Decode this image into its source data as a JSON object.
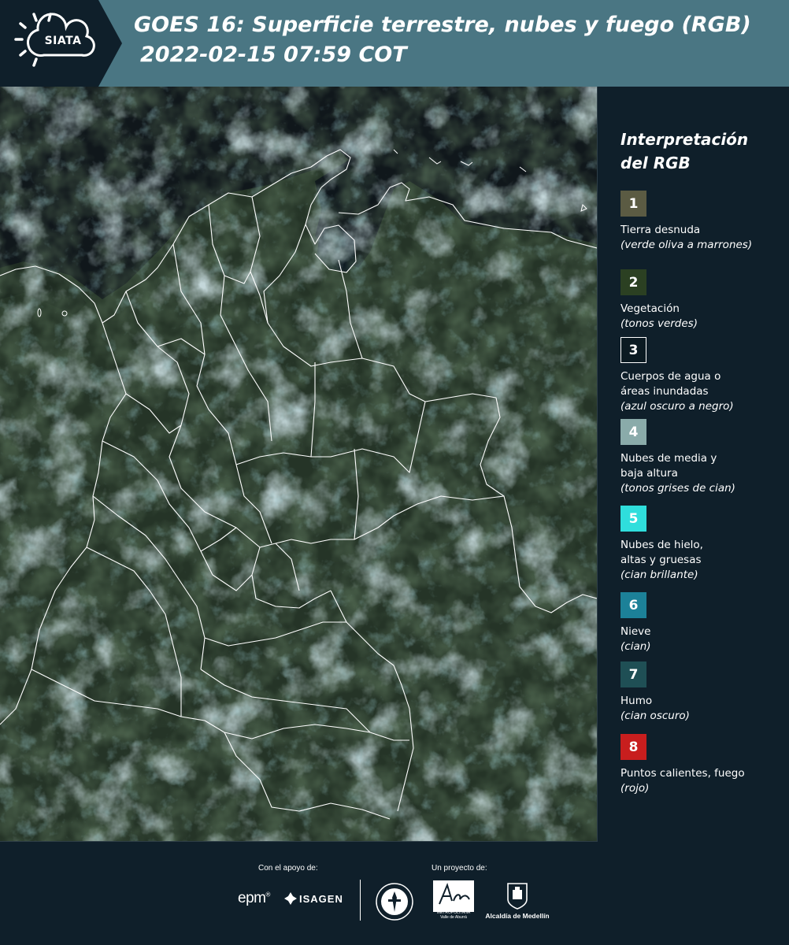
{
  "header": {
    "logo_text": "SIATA",
    "title_line1": "GOES 16: Superficie terrestre, nubes y fuego (RGB)",
    "title_line2": "2022-02-15 07:59 COT"
  },
  "map": {
    "type": "satellite-rgb-composite",
    "background_colors": {
      "sea": "#0f1519",
      "land": "#243226",
      "cloud": "#7c9aa0",
      "border": "#ffffff"
    }
  },
  "legend": {
    "title": "Interpretación del RGB",
    "items": [
      {
        "number": "1",
        "color": "#5b5b43",
        "label": "Tierra desnuda",
        "description": "(verde oliva a marrones)"
      },
      {
        "number": "2",
        "color": "#2b4022",
        "label": "Vegetación",
        "description": "(tonos verdes)"
      },
      {
        "number": "3",
        "color": "#0b1a22",
        "label": "Cuerpos de agua o\náreas inundadas",
        "description": "(azul oscuro a negro)"
      },
      {
        "number": "4",
        "color": "#8aabaa",
        "label": "Nubes de media y\nbaja altura",
        "description": "(tonos grises de cian)"
      },
      {
        "number": "5",
        "color": "#2fdedc",
        "label": "Nubes de hielo,\naltas y gruesas",
        "description": "(cian brillante)"
      },
      {
        "number": "6",
        "color": "#1c8198",
        "label": "Nieve",
        "description": "(cian)"
      },
      {
        "number": "7",
        "color": "#1f4f55",
        "label": "Humo",
        "description": "(cian oscuro)"
      },
      {
        "number": "8",
        "color": "#c81e1e",
        "label": "Puntos calientes, fuego",
        "description": "(rojo)"
      }
    ]
  },
  "footer": {
    "support_caption": "Con el apoyo de:",
    "project_caption": "Un proyecto de:",
    "sponsor1": "epm",
    "sponsor2": "ISAGEN",
    "partner_area_mark": "Área",
    "partner_area_sub": "METROPOLITANA\nValle de Aburrá",
    "partner_alcaldia": "Alcaldía de Medellín"
  }
}
